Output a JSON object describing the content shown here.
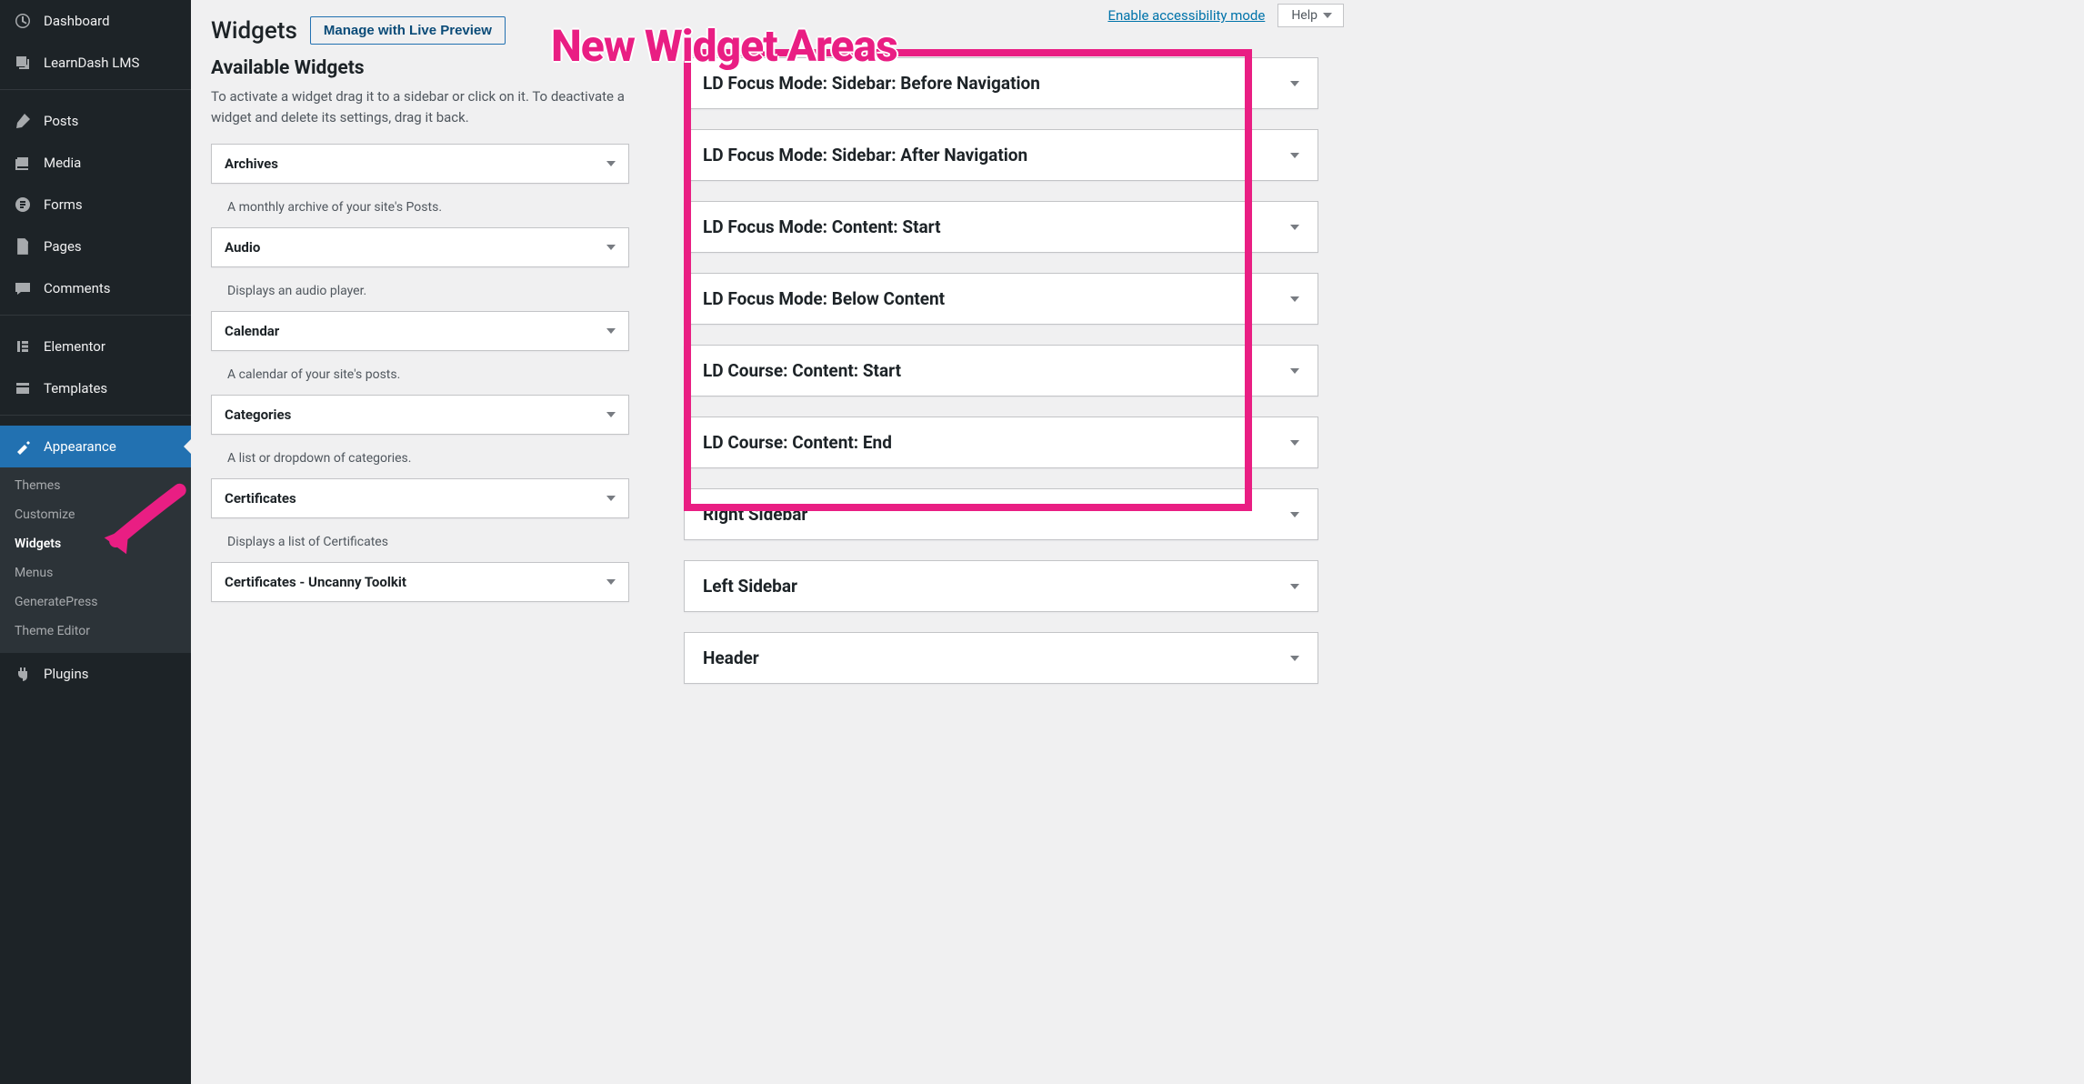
{
  "top": {
    "accessibility_link": "Enable accessibility mode",
    "help_label": "Help"
  },
  "header": {
    "title": "Widgets",
    "live_preview": "Manage with Live Preview"
  },
  "left_col": {
    "heading": "Available Widgets",
    "description": "To activate a widget drag it to a sidebar or click on it. To deactivate a widget and delete its settings, drag it back."
  },
  "side_menu": [
    {
      "label": "Dashboard",
      "icon": "dashboard"
    },
    {
      "label": "LearnDash LMS",
      "icon": "learndash"
    },
    {
      "label": "Posts",
      "icon": "posts",
      "sep": true
    },
    {
      "label": "Media",
      "icon": "media"
    },
    {
      "label": "Forms",
      "icon": "forms"
    },
    {
      "label": "Pages",
      "icon": "pages"
    },
    {
      "label": "Comments",
      "icon": "comments"
    },
    {
      "label": "Elementor",
      "icon": "elementor",
      "sep": true
    },
    {
      "label": "Templates",
      "icon": "templates"
    },
    {
      "label": "Appearance",
      "icon": "appearance",
      "sep": true,
      "current": true
    },
    {
      "label": "Plugins",
      "icon": "plugins"
    }
  ],
  "submenu": [
    {
      "label": "Themes"
    },
    {
      "label": "Customize"
    },
    {
      "label": "Widgets",
      "current": true
    },
    {
      "label": "Menus"
    },
    {
      "label": "GeneratePress"
    },
    {
      "label": "Theme Editor"
    }
  ],
  "available_widgets": [
    {
      "name": "Archives",
      "desc": "A monthly archive of your site's Posts."
    },
    {
      "name": "Audio",
      "desc": "Displays an audio player."
    },
    {
      "name": "Calendar",
      "desc": "A calendar of your site's posts."
    },
    {
      "name": "Categories",
      "desc": "A list or dropdown of categories."
    },
    {
      "name": "Certificates",
      "desc": "Displays a list of Certificates"
    },
    {
      "name": "Certificates - Uncanny Toolkit",
      "desc": ""
    }
  ],
  "widget_areas": [
    {
      "name": "LD Focus Mode: Sidebar: Before Navigation",
      "highlight": true
    },
    {
      "name": "LD Focus Mode: Sidebar: After Navigation",
      "highlight": true
    },
    {
      "name": "LD Focus Mode: Content: Start",
      "highlight": true
    },
    {
      "name": "LD Focus Mode: Below Content",
      "highlight": true
    },
    {
      "name": "LD Course: Content: Start",
      "highlight": true
    },
    {
      "name": "LD Course: Content: End",
      "highlight": true
    },
    {
      "name": "Right Sidebar"
    },
    {
      "name": "Left Sidebar"
    },
    {
      "name": "Header"
    }
  ],
  "annotation": {
    "title": "New Widget Areas"
  }
}
